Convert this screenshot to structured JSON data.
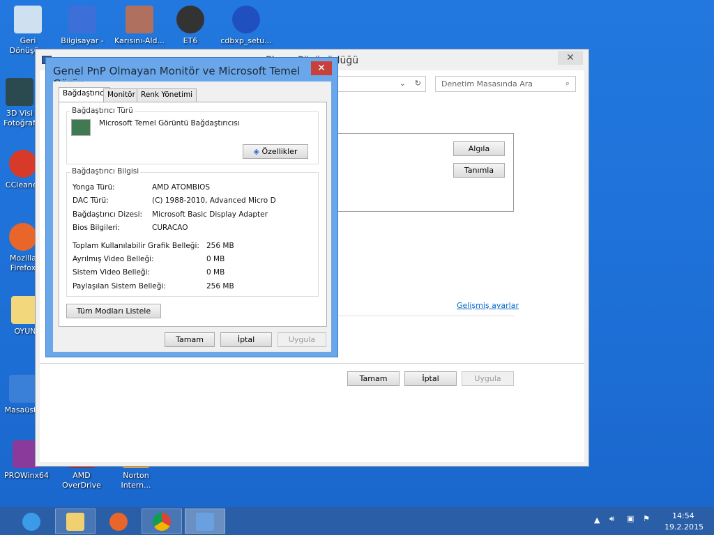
{
  "desktop": {
    "icons": [
      {
        "label": "Geri Dönüşüm"
      },
      {
        "label": "Bilgisayar -"
      },
      {
        "label": "Karısını-Ald..."
      },
      {
        "label": "ET6"
      },
      {
        "label": "cdbxp_setu..."
      },
      {
        "label": "3D Visi Fotoğraf"
      },
      {
        "label": "CCleaner"
      },
      {
        "label": "Mozilla Firefox"
      },
      {
        "label": "OYUN"
      },
      {
        "label": "Masaüstü"
      },
      {
        "label": "PROWinx64"
      },
      {
        "label": "AMD OverDrive"
      },
      {
        "label": "Norton Intern..."
      }
    ]
  },
  "back_window": {
    "title": "Ekran Çözünürlüğü",
    "close": "✕",
    "search_placeholder": "Denetim Masasında Ara",
    "detect": "Algıla",
    "identify": "Tanımla",
    "advanced_link": "Gelişmiş ayarlar",
    "ok": "Tamam",
    "cancel": "İptal",
    "apply": "Uygula"
  },
  "dialog": {
    "title": "Genel PnP Olmayan Monitör ve Microsoft Temel Görün...",
    "close": "✕",
    "tabs": [
      "Bağdaştırıcı",
      "Monitör",
      "Renk Yönetimi"
    ],
    "adapter_type_label": "Bağdaştırıcı Türü",
    "adapter_name": "Microsoft Temel Görüntü Bağdaştırıcısı",
    "properties": "Özellikler",
    "info_label": "Bağdaştırıcı Bilgisi",
    "info": [
      {
        "k": "Yonga Türü:",
        "v": "AMD ATOMBIOS"
      },
      {
        "k": "DAC Türü:",
        "v": "(C) 1988-2010, Advanced Micro D"
      },
      {
        "k": "Bağdaştırıcı Dizesi:",
        "v": "Microsoft Basic Display Adapter"
      },
      {
        "k": "Bios Bilgileri:",
        "v": "CURACAO"
      }
    ],
    "memory": [
      {
        "k": "Toplam Kullanılabilir Grafik Belleği:",
        "v": "256 MB"
      },
      {
        "k": "Ayrılmış Video Belleği:",
        "v": "0 MB"
      },
      {
        "k": "Sistem Video Belleği:",
        "v": "0 MB"
      },
      {
        "k": "Paylaşılan Sistem Belleği:",
        "v": "256 MB"
      }
    ],
    "list_modes": "Tüm Modları Listele",
    "ok": "Tamam",
    "cancel": "İptal",
    "apply": "Uygula"
  },
  "taskbar": {
    "time": "14:54",
    "date": "19.2.2015"
  }
}
